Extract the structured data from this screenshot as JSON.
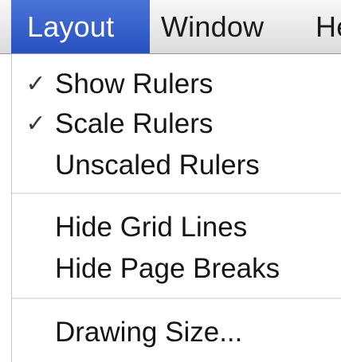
{
  "menubar": {
    "items": [
      {
        "label": "Layout"
      },
      {
        "label": "Window"
      },
      {
        "label": "He"
      }
    ],
    "active_item": "Layout"
  },
  "menu": {
    "items": [
      {
        "label": "Show Rulers",
        "checked": true,
        "check_glyph": "✓"
      },
      {
        "label": "Scale Rulers",
        "checked": true,
        "check_glyph": "✓"
      },
      {
        "label": "Unscaled Rulers",
        "checked": false
      },
      {
        "label": "Hide Grid Lines",
        "checked": false
      },
      {
        "label": "Hide Page Breaks",
        "checked": false
      },
      {
        "label": "Drawing Size...",
        "checked": false
      }
    ]
  },
  "colors": {
    "menubar_bg": "#e6e6e6",
    "active_menu_bg": "#3560cc",
    "active_menu_text": "#ffffff",
    "menu_text": "#141414",
    "separator": "#e4e4e4"
  }
}
